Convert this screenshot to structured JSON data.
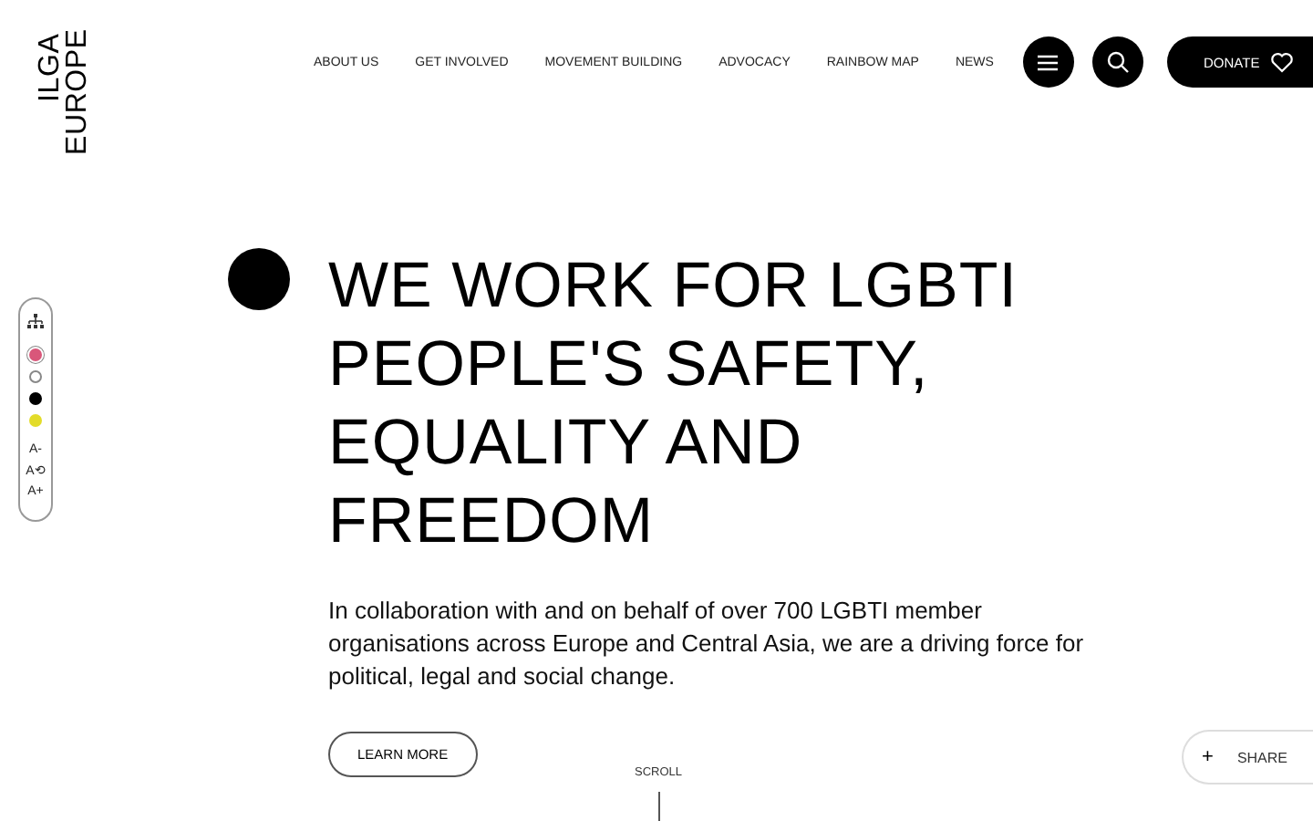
{
  "logo": {
    "lines": [
      "ILGA",
      "EUROPE"
    ]
  },
  "nav": [
    "ABOUT US",
    "GET INVOLVED",
    "MOVEMENT BUILDING",
    "ADVOCACY",
    "RAINBOW MAP",
    "NEWS"
  ],
  "donate": "DONATE",
  "accessibility": {
    "colors": [
      {
        "color": "#d9577a",
        "selected": true
      },
      {
        "color": "#ffffff",
        "selected": false
      },
      {
        "color": "#000000",
        "selected": false
      },
      {
        "color": "#e3dc2a",
        "selected": false
      }
    ],
    "font_controls": [
      "A-",
      "A⟲",
      "A+"
    ]
  },
  "hero": {
    "heading": [
      "WE WORK FOR LGBTI",
      "PEOPLE'S SAFETY,",
      "EQUALITY AND",
      "FREEDOM"
    ],
    "text": "In collaboration with and on behalf of over 700 LGBTI member organisations across Europe and Central Asia, we are a driving force for political, legal and social change.",
    "button": "LEARN MORE"
  },
  "scroll": "SCROLL",
  "share": {
    "icon": "+",
    "label": "SHARE"
  }
}
